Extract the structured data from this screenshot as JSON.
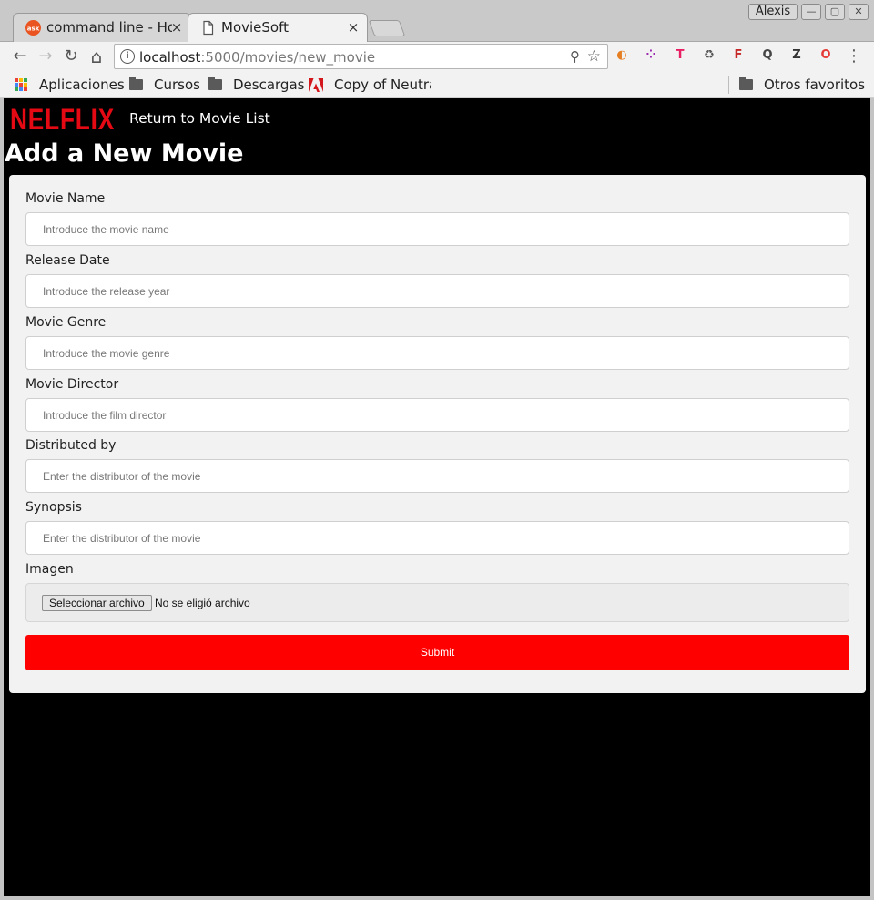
{
  "browser": {
    "tabs": [
      {
        "title": "command line - How",
        "favicon": "askubuntu-icon",
        "close": "×"
      },
      {
        "title": "MovieSoft",
        "favicon": "page-icon",
        "close": "×"
      }
    ],
    "user": "Alexis",
    "window_controls": {
      "minimize": "—",
      "maximize": "▢",
      "close": "✕"
    },
    "address": {
      "host": "localhost",
      "path": ":5000/movies/new_movie"
    },
    "nav_icons": {
      "back": "←",
      "forward": "→",
      "reload": "↻",
      "home": "⌂",
      "zoom": "⚲",
      "star": "☆",
      "menu": "⋮"
    },
    "extensions": [
      {
        "name": "extension-icon",
        "glyph": "◐",
        "color": "#e67e22"
      },
      {
        "name": "extension-icon",
        "glyph": "⁘",
        "color": "#9b27b0"
      },
      {
        "name": "extension-icon",
        "glyph": "T",
        "color": "#e91e63"
      },
      {
        "name": "recycle-icon",
        "glyph": "♻",
        "color": "#555555"
      },
      {
        "name": "extension-icon",
        "glyph": "F",
        "color": "#c62828"
      },
      {
        "name": "extension-icon",
        "glyph": "Q",
        "color": "#444444"
      },
      {
        "name": "extension-icon",
        "glyph": "Z",
        "color": "#333333"
      },
      {
        "name": "opera-icon",
        "glyph": "O",
        "color": "#e53935"
      }
    ],
    "bookmarks": {
      "apps": "Aplicaciones",
      "items": [
        "Cursos",
        "Descargas",
        "Copy of Neutral"
      ],
      "other": "Otros favoritos"
    }
  },
  "site": {
    "logo": "NELFLIX",
    "nav_link": "Return to Movie List",
    "page_title": "Add a New Movie",
    "brand_color": "#e50914"
  },
  "form": {
    "fields": [
      {
        "label": "Movie Name",
        "placeholder": "Introduce the movie name"
      },
      {
        "label": "Release Date",
        "placeholder": "Introduce the release year"
      },
      {
        "label": "Movie Genre",
        "placeholder": "Introduce the movie genre"
      },
      {
        "label": "Movie Director",
        "placeholder": "Introduce the film director"
      },
      {
        "label": "Distributed by",
        "placeholder": "Enter the distributor of the movie"
      },
      {
        "label": "Synopsis",
        "placeholder": "Enter the distributor of the movie"
      }
    ],
    "image": {
      "label": "Imagen",
      "button": "Seleccionar archivo",
      "status": "No se eligió archivo"
    },
    "submit": "Submit",
    "submit_color": "#ff0000"
  }
}
